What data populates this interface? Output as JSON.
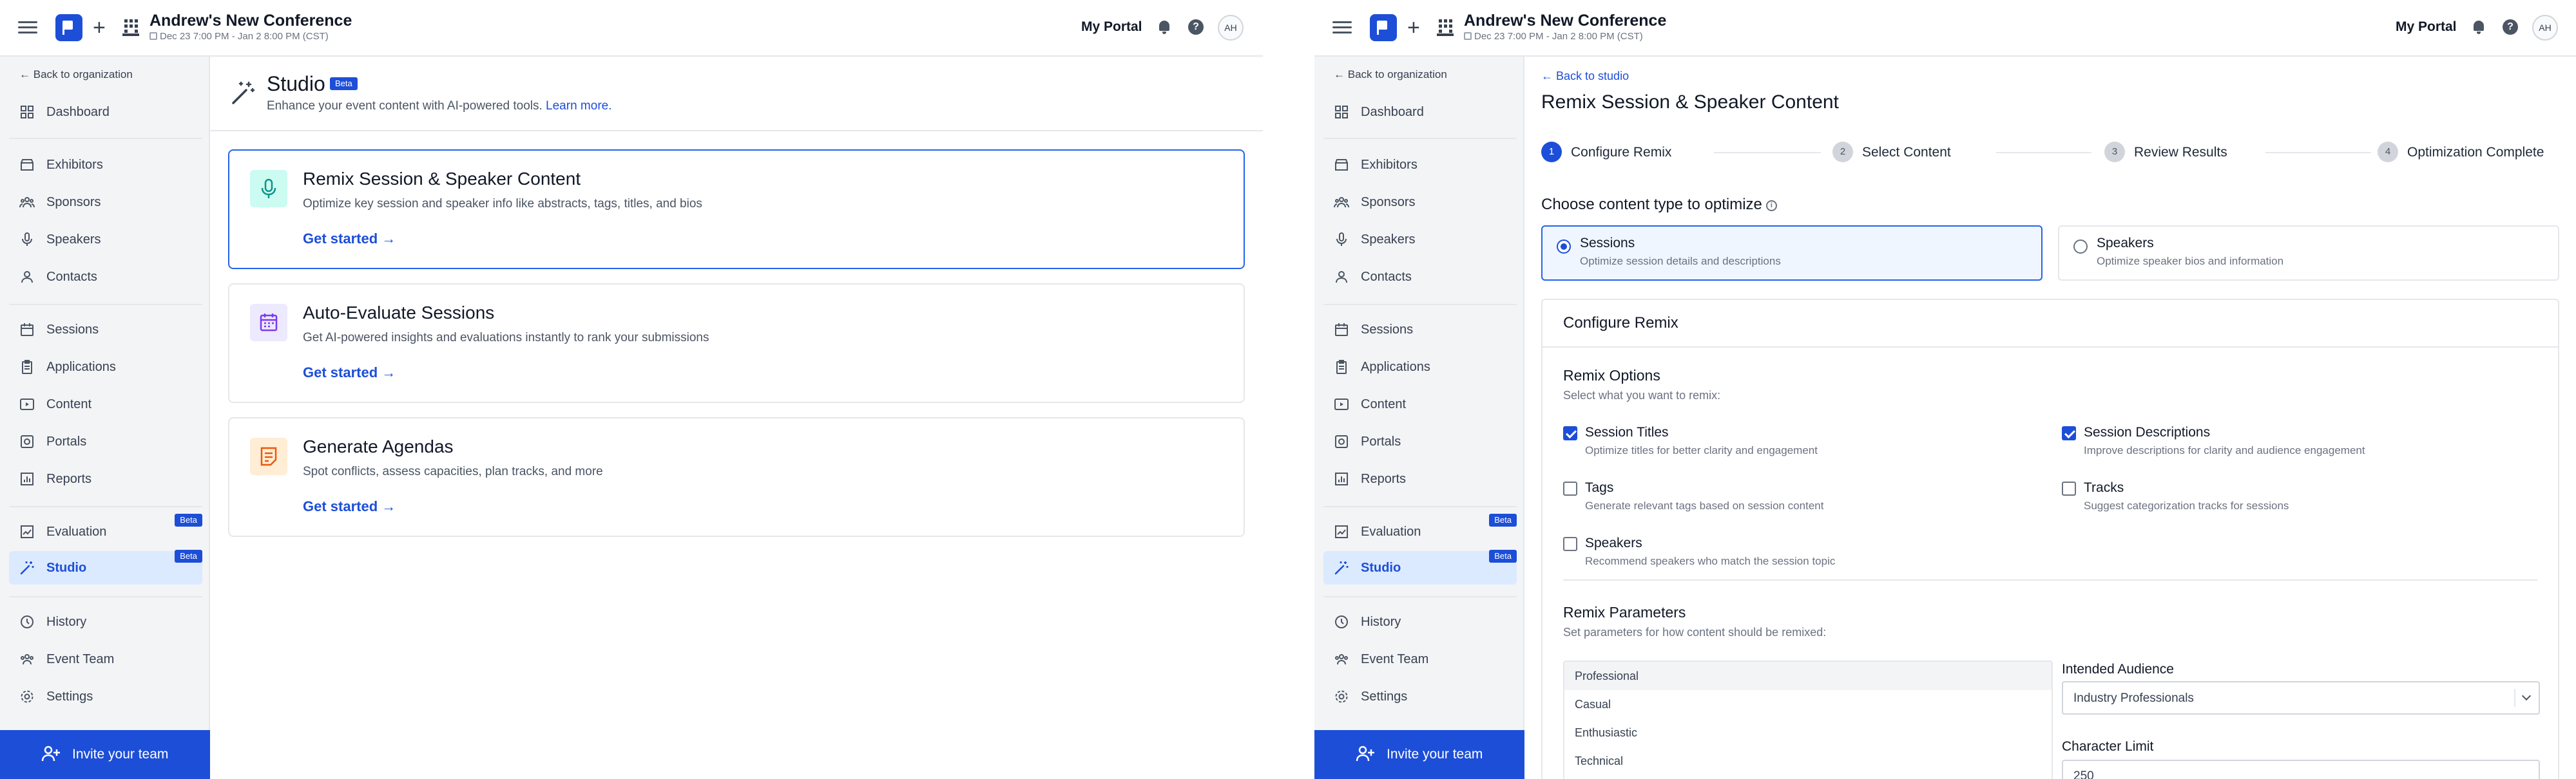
{
  "header": {
    "title": "Andrew's New Conference",
    "date": "Dec 23 7:00 PM - Jan 2 8:00 PM (CST)",
    "portal": "My Portal",
    "avatar": "AH"
  },
  "sidebar": {
    "back": "Back to organization",
    "items": [
      {
        "label": "Dashboard",
        "icon": "dashboard-icon"
      },
      {
        "label": "Exhibitors",
        "icon": "store-icon"
      },
      {
        "label": "Sponsors",
        "icon": "users-icon"
      },
      {
        "label": "Speakers",
        "icon": "microphone-icon"
      },
      {
        "label": "Contacts",
        "icon": "person-icon"
      },
      {
        "label": "Sessions",
        "icon": "calendar-icon"
      },
      {
        "label": "Applications",
        "icon": "clipboard-icon"
      },
      {
        "label": "Content",
        "icon": "play-icon"
      },
      {
        "label": "Portals",
        "icon": "portal-icon"
      },
      {
        "label": "Reports",
        "icon": "chart-icon"
      },
      {
        "label": "Evaluation",
        "icon": "evaluation-icon",
        "badge": "Beta"
      },
      {
        "label": "Studio",
        "icon": "wand-icon",
        "badge": "Beta",
        "active": true
      },
      {
        "label": "History",
        "icon": "history-icon"
      },
      {
        "label": "Event Team",
        "icon": "team-icon"
      },
      {
        "label": "Settings",
        "icon": "gear-icon"
      }
    ],
    "invite": "Invite your team"
  },
  "studio": {
    "title": "Studio",
    "badge": "Beta",
    "description": "Enhance your event content with AI-powered tools.",
    "learn_more": "Learn more.",
    "cards": [
      {
        "title": "Remix Session & Speaker Content",
        "description": "Optimize key session and speaker info like abstracts, tags, titles, and bios",
        "cta": "Get started",
        "icon": "microphone-icon",
        "color": "#0d9488"
      },
      {
        "title": "Auto-Evaluate Sessions",
        "description": "Get AI-powered insights and evaluations instantly to rank your submissions",
        "cta": "Get started",
        "icon": "calendar-icon",
        "color": "#7c3aed"
      },
      {
        "title": "Generate Agendas",
        "description": "Spot conflicts, assess capacities, plan tracks, and more",
        "cta": "Get started",
        "icon": "agenda-icon",
        "color": "#ea580c"
      }
    ]
  },
  "remix": {
    "back": "Back to studio",
    "title": "Remix Session & Speaker Content",
    "steps": [
      {
        "num": "1",
        "label": "Configure Remix",
        "active": true
      },
      {
        "num": "2",
        "label": "Select Content"
      },
      {
        "num": "3",
        "label": "Review Results"
      },
      {
        "num": "4",
        "label": "Optimization Complete"
      }
    ],
    "choose_label": "Choose content type to optimize",
    "types": [
      {
        "title": "Sessions",
        "description": "Optimize session details and descriptions",
        "selected": true
      },
      {
        "title": "Speakers",
        "description": "Optimize speaker bios and information",
        "selected": false
      }
    ],
    "config_title": "Configure Remix",
    "options_title": "Remix Options",
    "options_sub": "Select what you want to remix:",
    "options": [
      {
        "title": "Session Titles",
        "description": "Optimize titles for better clarity and engagement",
        "checked": true
      },
      {
        "title": "Session Descriptions",
        "description": "Improve descriptions for clarity and audience engagement",
        "checked": true
      },
      {
        "title": "Tags",
        "description": "Generate relevant tags based on session content",
        "checked": false
      },
      {
        "title": "Tracks",
        "description": "Suggest categorization tracks for sessions",
        "checked": false
      },
      {
        "title": "Speakers",
        "description": "Recommend speakers who match the session topic",
        "checked": false
      }
    ],
    "params_title": "Remix Parameters",
    "params_sub": "Set parameters for how content should be remixed:",
    "tones": [
      "Professional",
      "Casual",
      "Enthusiastic",
      "Technical"
    ],
    "audience_label": "Intended Audience",
    "audience_value": "Industry Professionals",
    "char_limit_label": "Character Limit",
    "char_limit_value": "250"
  },
  "colors": {
    "brand": "#1d4ed8",
    "active_bg": "#dbeafe",
    "sidebar_bg": "#f3f4f6"
  }
}
